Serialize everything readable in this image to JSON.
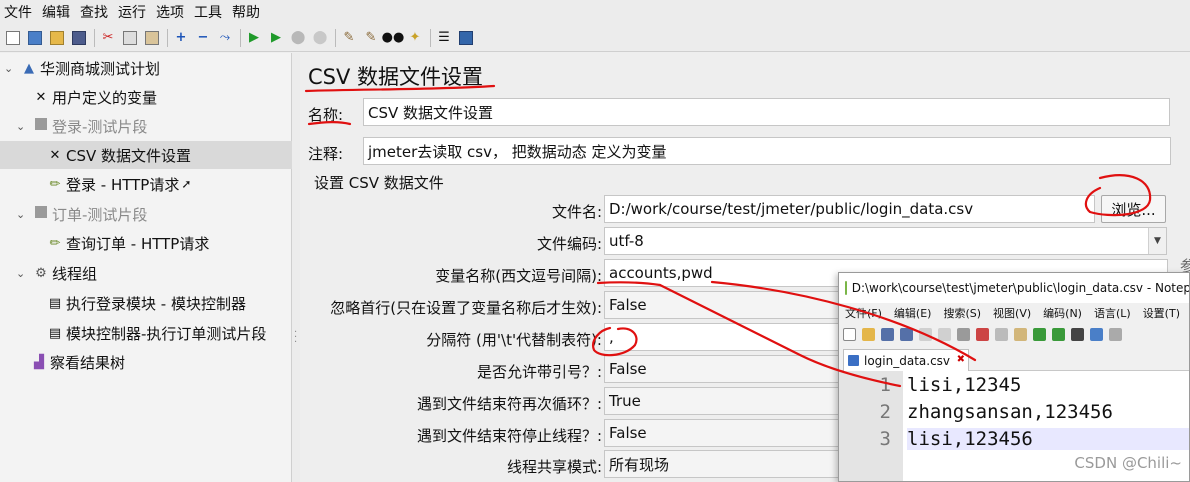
{
  "menubar": [
    "文件",
    "编辑",
    "查找",
    "运行",
    "选项",
    "工具",
    "帮助"
  ],
  "tree": {
    "root": "华测商城测试计划",
    "user_vars": "用户定义的变量",
    "login_fragment": "登录-测试片段",
    "csv_config": "CSV 数据文件设置",
    "login_http": "登录 - HTTP请求",
    "order_fragment": "订单-测试片段",
    "query_order": "查询订单 - HTTP请求",
    "thread_group": "线程组",
    "exec_login": "执行登录模块 - 模块控制器",
    "module_ctrl": "模块控制器-执行订单测试片段",
    "result_tree": "察看结果树"
  },
  "panel": {
    "title": "CSV 数据文件设置",
    "name_label": "名称:",
    "name_value": "CSV 数据文件设置",
    "comment_label": "注释:",
    "comment_value": "jmeter去读取 csv， 把数据动态 定义为变量",
    "section": "设置 CSV 数据文件",
    "filename_label": "文件名:",
    "filename_value": "D:/work/course/test/jmeter/public/login_data.csv",
    "browse": "浏览...",
    "encoding_label": "文件编码:",
    "encoding_value": "utf-8",
    "varnames_label": "变量名称(西文逗号间隔):",
    "varnames_value": "accounts,pwd",
    "ignore_label": "忽略首行(只在设置了变量名称后才生效):",
    "ignore_value": "False",
    "delim_label": "分隔符 (用'\\t'代替制表符):",
    "delim_value": ",",
    "quoted_label": "是否允许带引号？:",
    "quoted_value": "False",
    "recycle_label": "遇到文件结束符再次循环？:",
    "recycle_value": "True",
    "stop_label": "遇到文件结束符停止线程？:",
    "stop_value": "False",
    "share_label": "线程共享模式:",
    "share_value": "所有现场",
    "right_edge_char": "参"
  },
  "notepad": {
    "title": "D:\\work\\course\\test\\jmeter\\public\\login_data.csv - Notep",
    "menu": [
      "文件(F)",
      "编辑(E)",
      "搜索(S)",
      "视图(V)",
      "编码(N)",
      "语言(L)",
      "设置(T)"
    ],
    "tab": "login_data.csv",
    "lines": [
      {
        "num": "1",
        "text": "lisi,12345"
      },
      {
        "num": "2",
        "text": "zhangsansan,123456"
      },
      {
        "num": "3",
        "text": "lisi,123456"
      }
    ]
  },
  "watermark": "CSDN @Chili~"
}
